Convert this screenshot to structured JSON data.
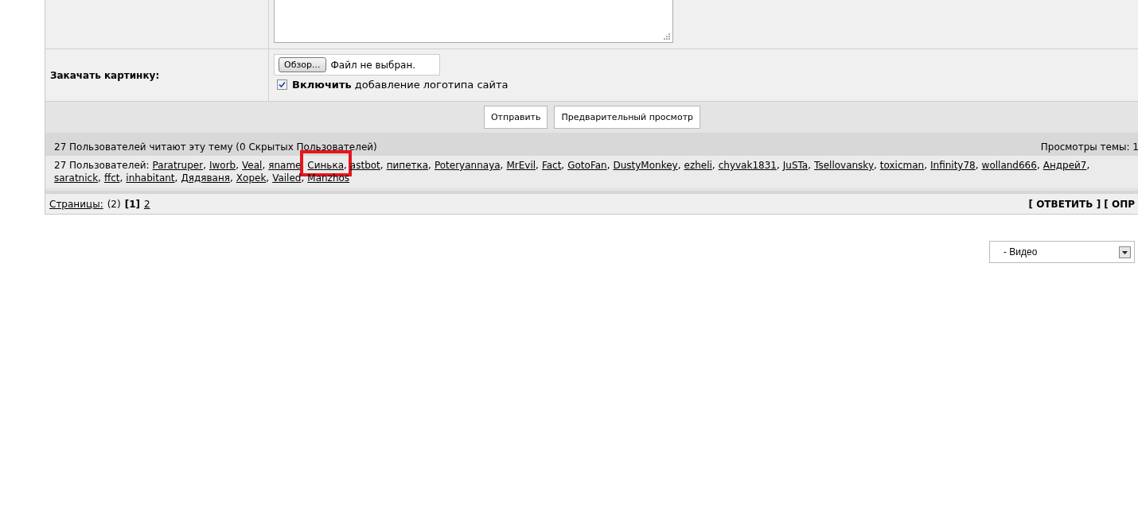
{
  "upload": {
    "label": "Закачать картинку:",
    "browse_button": "Обзор...",
    "file_status": "Файл не выбран.",
    "logo_option": {
      "checked": true,
      "text": "**Включить** добавление логотипа сайта"
    }
  },
  "buttons": [
    "Отправить",
    "Предварительный просмотр"
  ],
  "readers": {
    "summary": "27 Пользователей читают эту тему (0 Скрытых Пользователей)",
    "views": "Просмотры темы: 1",
    "prefix": "27 Пользователей:",
    "separator": ",",
    "users": [
      {
        "name": "Paratruper",
        "highlighted": false
      },
      {
        "name": "Iworb",
        "highlighted": false
      },
      {
        "name": "Veal",
        "highlighted": false
      },
      {
        "name": "яname",
        "highlighted": false
      },
      {
        "name": "Синька",
        "highlighted": true
      },
      {
        "name": "astbot",
        "highlighted": false
      },
      {
        "name": "пипетка",
        "highlighted": false
      },
      {
        "name": "Poteryannaya",
        "highlighted": false
      },
      {
        "name": "MrEvil",
        "highlighted": false
      },
      {
        "name": "Fact",
        "highlighted": false
      },
      {
        "name": "GotoFan",
        "highlighted": false
      },
      {
        "name": "DustyMonkey",
        "highlighted": false
      },
      {
        "name": "ezheli",
        "highlighted": false
      },
      {
        "name": "chyvak1831",
        "highlighted": false
      },
      {
        "name": "JuSTa",
        "highlighted": false
      },
      {
        "name": "Tsellovansky",
        "highlighted": false
      },
      {
        "name": "toxicman",
        "highlighted": false
      },
      {
        "name": "Infinity78",
        "highlighted": false
      },
      {
        "name": "wolland666",
        "highlighted": false
      },
      {
        "name": "Андрей7",
        "highlighted": false
      },
      {
        "name": "saratnick",
        "highlighted": false
      },
      {
        "name": "ffct",
        "highlighted": false
      },
      {
        "name": "inhabitant",
        "highlighted": false
      },
      {
        "name": "Дядяваня",
        "highlighted": false
      },
      {
        "name": "Xopek",
        "highlighted": false
      },
      {
        "name": "Vailed",
        "highlighted": false
      },
      {
        "name": "Manzhos",
        "highlighted": false
      }
    ]
  },
  "pages": {
    "label": "Страницы:",
    "count": "(2)",
    "items": [
      {
        "label": "[1]",
        "selected": true
      },
      {
        "label": "2",
        "selected": false
      }
    ],
    "actions": "[ ОТВЕТИТЬ ] [ ОПР"
  },
  "forum_select": {
    "value": "- Видео"
  }
}
